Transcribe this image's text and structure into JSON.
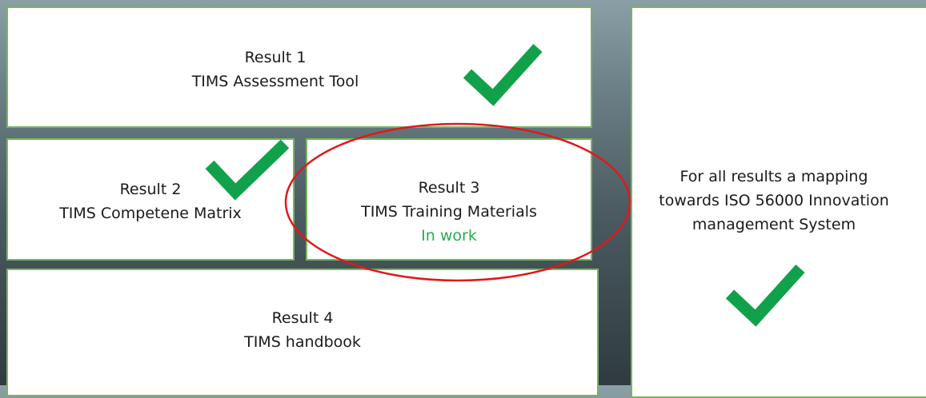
{
  "results": [
    {
      "id": "result-1",
      "number_label": "Result 1",
      "title": "TIMS Assessment Tool",
      "status": "",
      "done": true
    },
    {
      "id": "result-2",
      "number_label": "Result 2",
      "title": "TIMS Competene Matrix",
      "status": "",
      "done": true
    },
    {
      "id": "result-3",
      "number_label": "Result 3",
      "title": "TIMS Training Materials",
      "status": "In work",
      "done": false,
      "highlighted": true
    },
    {
      "id": "result-4",
      "number_label": "Result 4",
      "title": "TIMS handbook",
      "status": "",
      "done": false
    }
  ],
  "mapping": {
    "lines": [
      "For all results a mapping",
      "towards ISO 56000 Innovation",
      "management System"
    ],
    "done": true
  },
  "colors": {
    "box_border": "#77b65a",
    "checkmark": "#12a14b",
    "status_text": "#27ae4f",
    "highlight_ring": "#e01919"
  },
  "icons": {
    "check": "checkmark-icon",
    "highlight": "highlight-ellipse"
  }
}
